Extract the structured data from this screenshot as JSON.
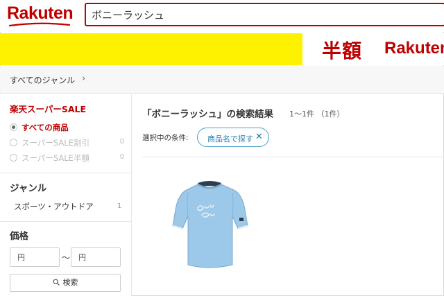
{
  "header": {
    "logo_text": "Rakuten",
    "search_value": "ボニーラッシュ"
  },
  "banner": {
    "hangaku_text": "半額",
    "brand_text": "Rakuten"
  },
  "breadcrumb": {
    "label": "すべてのジャンル",
    "arrow": "›"
  },
  "sidebar": {
    "sale_title": "楽天スーパーSALE",
    "sale_options": [
      {
        "label": "すべての商品",
        "count": "",
        "selected": true
      },
      {
        "label": "スーパーSALE割引",
        "count": "0",
        "selected": false
      },
      {
        "label": "スーパーSALE半額",
        "count": "0",
        "selected": false
      }
    ],
    "genre_title": "ジャンル",
    "genre_item": {
      "label": "スポーツ・アウトドア",
      "count": "1"
    },
    "price_title": "価格",
    "price_min_placeholder": "円",
    "price_max_placeholder": "円",
    "price_separator": "〜",
    "search_button_label": "検索"
  },
  "main": {
    "result_title": "「ボニーラッシュ」の検索結果",
    "result_count": "1〜1件 （1件）",
    "condition_label": "選択中の条件:",
    "chip_label": "商品名で探す",
    "chip_close": "✕"
  },
  "colors": {
    "brand_red": "#bf0000",
    "banner_yellow": "#fff200",
    "chip_blue": "#1f7ab0",
    "shirt_blue": "#9cc8ea"
  }
}
